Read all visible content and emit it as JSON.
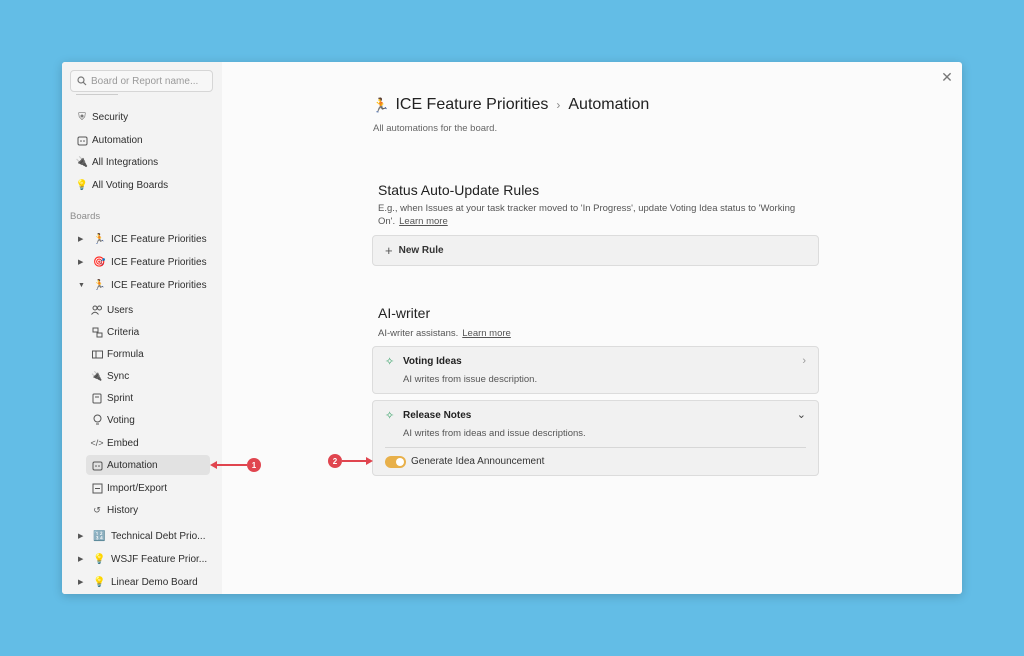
{
  "sidebar": {
    "search_placeholder": "Board or Report name...",
    "top_items": [
      {
        "label": "Security",
        "icon": "shield-icon"
      },
      {
        "label": "Automation",
        "icon": "robot-icon"
      },
      {
        "label": "All Integrations",
        "icon": "plug-icon"
      },
      {
        "label": "All Voting Boards",
        "icon": "lightbulb-icon"
      }
    ],
    "boards_label": "Boards",
    "boards": [
      {
        "label": "ICE Feature Priorities",
        "emoji": "🏃",
        "expanded": false
      },
      {
        "label": "ICE Feature Priorities",
        "emoji": "🎯",
        "expanded": false
      },
      {
        "label": "ICE Feature Priorities",
        "emoji": "🏃",
        "expanded": true
      }
    ],
    "sub_items": [
      {
        "label": "Users",
        "icon": "users-icon"
      },
      {
        "label": "Criteria",
        "icon": "criteria-icon"
      },
      {
        "label": "Formula",
        "icon": "formula-icon"
      },
      {
        "label": "Sync",
        "icon": "plug-icon"
      },
      {
        "label": "Sprint",
        "icon": "sprint-icon"
      },
      {
        "label": "Voting",
        "icon": "lightbulb-icon"
      },
      {
        "label": "Embed",
        "icon": "code-icon"
      },
      {
        "label": "Automation",
        "icon": "robot-icon",
        "active": true
      },
      {
        "label": "Import/Export",
        "icon": "import-icon"
      },
      {
        "label": "History",
        "icon": "history-icon"
      }
    ],
    "more_boards": [
      {
        "label": "Technical Debt Prio...",
        "emoji": "🔢"
      },
      {
        "label": "WSJF Feature Prior...",
        "emoji": "💡"
      },
      {
        "label": "Linear Demo Board",
        "emoji": "💡"
      }
    ]
  },
  "header": {
    "emoji": "🏃",
    "board_title": "ICE Feature Priorities",
    "separator": "›",
    "page_title": "Automation",
    "subtitle": "All automations for the board."
  },
  "status_rules": {
    "title": "Status Auto-Update Rules",
    "description": "E.g., when Issues at your task tracker moved to 'In Progress', update Voting Idea status to 'Working On'.",
    "learn_more": "Learn more",
    "new_rule_label": "New Rule"
  },
  "ai_writer": {
    "title": "AI-writer",
    "description": "AI-writer assistans.",
    "learn_more": "Learn more",
    "cards": [
      {
        "title": "Voting Ideas",
        "subtitle": "AI writes from issue description."
      },
      {
        "title": "Release Notes",
        "subtitle": "AI writes from ideas and issue descriptions.",
        "toggle_label": "Generate Idea Announcement",
        "toggle_on": true
      }
    ]
  },
  "annotations": {
    "callout_1": "1",
    "callout_2": "2"
  },
  "colors": {
    "background": "#63bde6",
    "accent_toggle": "#e8b04a",
    "callout": "#e0454f",
    "spark": "#3aa36a"
  }
}
